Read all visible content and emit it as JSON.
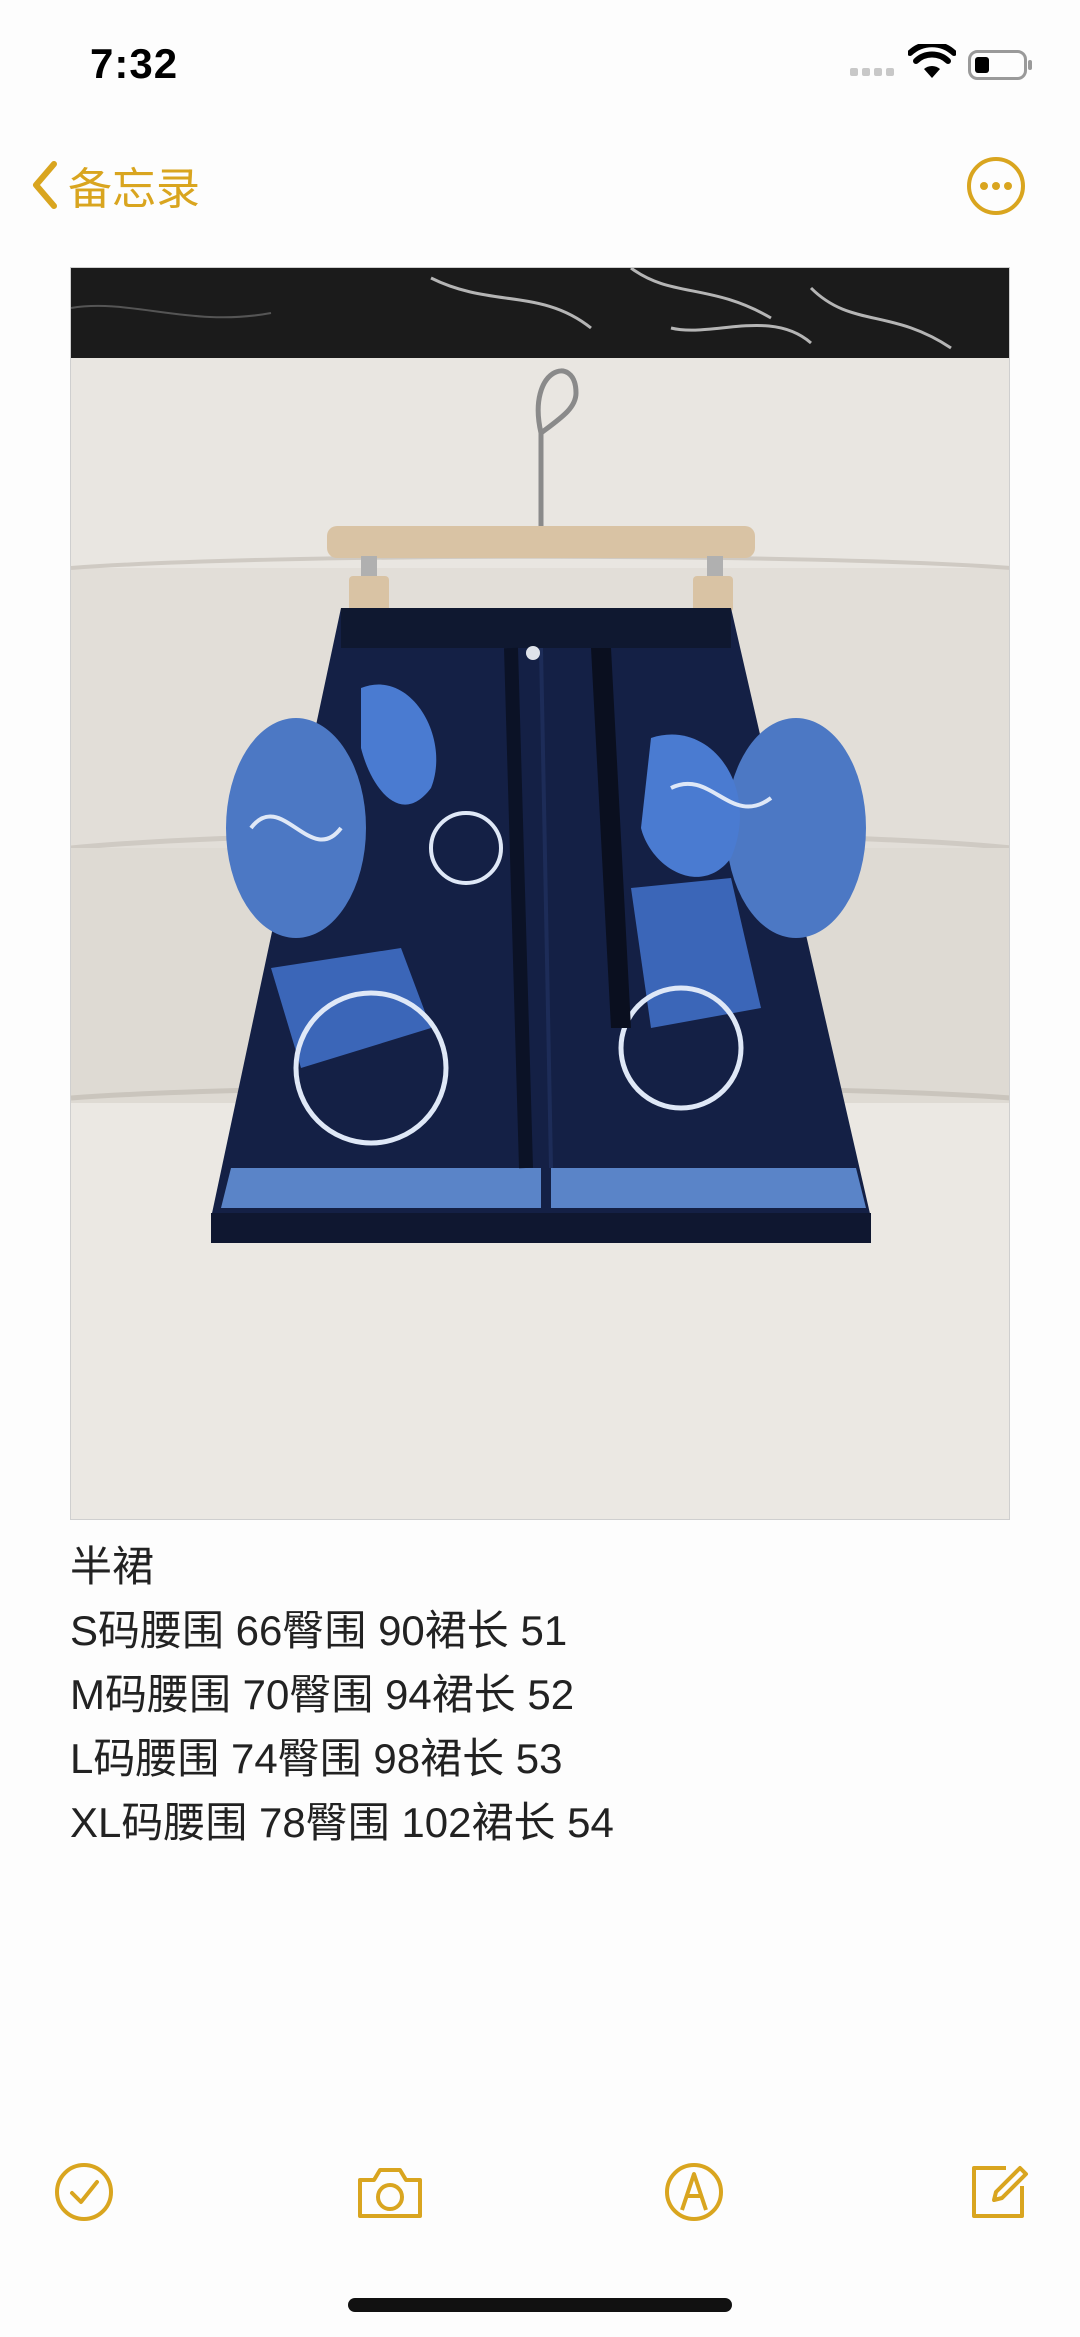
{
  "status_bar": {
    "time": "7:32"
  },
  "nav": {
    "back_label": "备忘录",
    "back_icon": "chevron-left-icon",
    "more_icon": "ellipsis-circle-icon"
  },
  "note": {
    "lines": [
      "半裙",
      "S码腰围 66臀围 90裙长 51",
      "M码腰围 70臀围 94裙长 52",
      "L码腰围 74臀围 98裙长 53",
      "XL码腰围 78臀围 102裙长 54"
    ]
  },
  "toolbar": {
    "checklist_icon": "checkmark-circle-icon",
    "camera_icon": "camera-icon",
    "markup_icon": "pen-circle-icon",
    "compose_icon": "compose-icon"
  },
  "colors": {
    "accent": "#d9a51f",
    "text": "#222222",
    "background": "#fdfdfd"
  }
}
